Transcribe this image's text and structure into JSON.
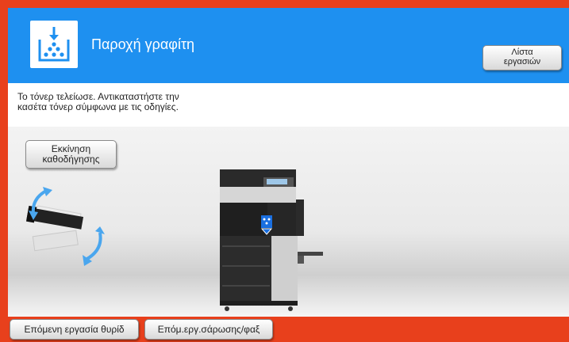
{
  "header": {
    "title": "Παροχή γραφίτη",
    "jobs_button": {
      "line1": "Λίστα",
      "line2": "εργασιών"
    },
    "icon": "toner-supply-icon"
  },
  "message": {
    "line1": "Το τόνερ τελείωσε. Αντικαταστήστε την",
    "line2": "κασέτα τόνερ σύμφωνα με τις οδηγίες."
  },
  "guide_button": {
    "line1": "Εκκίνηση",
    "line2": "καθοδήγησης"
  },
  "footer": {
    "next_job_button": "Επόμενη εργασία θυρίδ",
    "next_scan_fax_button": "Επόμ.εργ.σάρωσης/φαξ"
  },
  "colors": {
    "header_blue": "#1e90f0",
    "frame_orange": "#e8401c",
    "toner_blue": "#1565d8"
  }
}
